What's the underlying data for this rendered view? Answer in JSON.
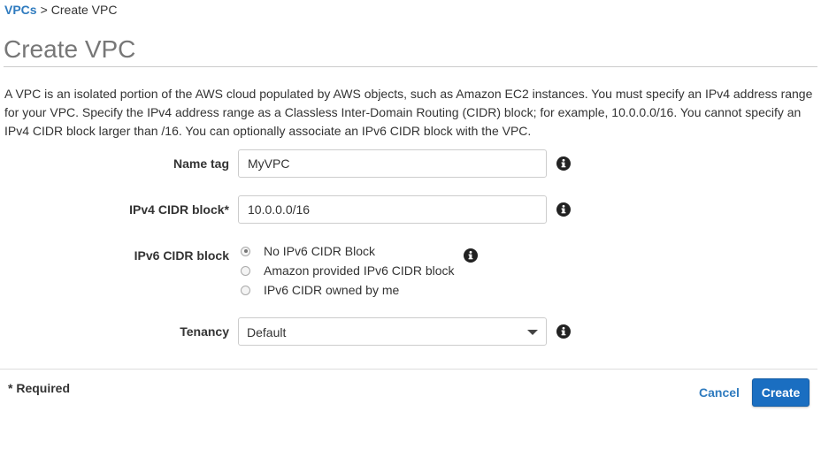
{
  "breadcrumb": {
    "parent": "VPCs",
    "separator": ">",
    "current": "Create VPC"
  },
  "page": {
    "title": "Create VPC",
    "description": "A VPC is an isolated portion of the AWS cloud populated by AWS objects, such as Amazon EC2 instances. You must specify an IPv4 address range for your VPC. Specify the IPv4 address range as a Classless Inter-Domain Routing (CIDR) block; for example, 10.0.0.0/16. You cannot specify an IPv4 CIDR block larger than /16. You can optionally associate an IPv6 CIDR block with the VPC."
  },
  "form": {
    "name_tag": {
      "label": "Name tag",
      "value": "MyVPC",
      "info_icon": "info-circle-icon"
    },
    "ipv4_cidr": {
      "label": "IPv4 CIDR block*",
      "value": "10.0.0.0/16",
      "info_icon": "info-circle-icon"
    },
    "ipv6_cidr": {
      "label": "IPv6 CIDR block",
      "options": [
        {
          "label": "No IPv6 CIDR Block",
          "selected": true
        },
        {
          "label": "Amazon provided IPv6 CIDR block",
          "selected": false
        },
        {
          "label": "IPv6 CIDR owned by me",
          "selected": false
        }
      ],
      "info_icon": "info-circle-icon"
    },
    "tenancy": {
      "label": "Tenancy",
      "selected": "Default",
      "info_icon": "info-circle-icon"
    }
  },
  "footer": {
    "required_note": "* Required",
    "cancel_label": "Cancel",
    "create_label": "Create"
  },
  "colors": {
    "link": "#2f7bbf",
    "primary_button": "#1a6ec1",
    "title": "#777777",
    "text": "#333333"
  }
}
